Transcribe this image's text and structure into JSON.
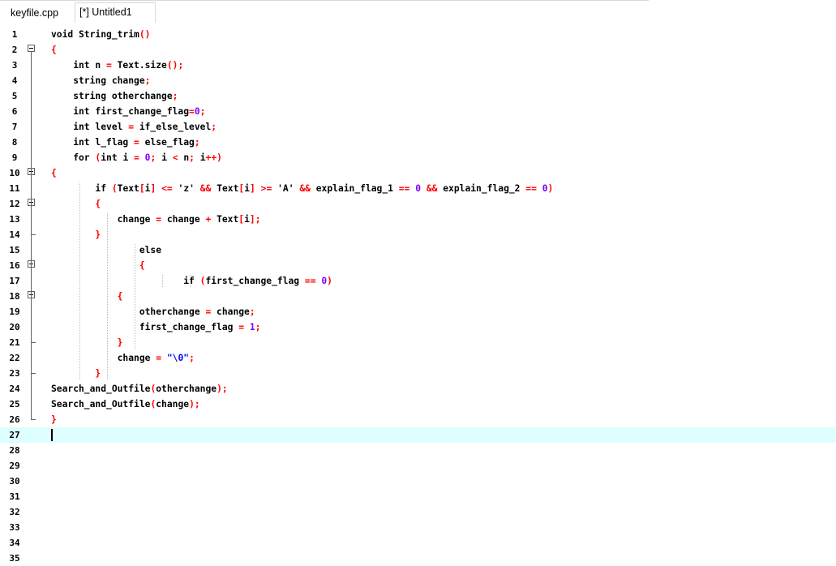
{
  "tabs": [
    {
      "label": "keyfile.cpp",
      "active": false
    },
    {
      "label": "[*] Untitled1",
      "active": true
    }
  ],
  "editor": {
    "current_line": 27,
    "lines": [
      {
        "n": "1",
        "code": "void String_trim()"
      },
      {
        "n": "2",
        "code": "{"
      },
      {
        "n": "3",
        "code": "    int n = Text.size();"
      },
      {
        "n": "4",
        "code": "    string change;"
      },
      {
        "n": "5",
        "code": "    string otherchange;"
      },
      {
        "n": "6",
        "code": "    int first_change_flag=0;"
      },
      {
        "n": "7",
        "code": "    int level = if_else_level;"
      },
      {
        "n": "8",
        "code": "    int l_flag = else_flag;"
      },
      {
        "n": "9",
        "code": "    for (int i = 0; i < n; i++)"
      },
      {
        "n": "10",
        "code": "{"
      },
      {
        "n": "11",
        "code": "        if (Text[i] <= 'z' && Text[i] >= 'A' && explain_flag_1 == 0 && explain_flag_2 == 0)"
      },
      {
        "n": "12",
        "code": "        {"
      },
      {
        "n": "13",
        "code": "            change = change + Text[i];"
      },
      {
        "n": "14",
        "code": "        }"
      },
      {
        "n": "15",
        "code": "                else"
      },
      {
        "n": "16",
        "code": "                {"
      },
      {
        "n": "17",
        "code": "                        if (first_change_flag == 0)"
      },
      {
        "n": "18",
        "code": "            {"
      },
      {
        "n": "19",
        "code": "                otherchange = change;"
      },
      {
        "n": "20",
        "code": "                first_change_flag = 1;"
      },
      {
        "n": "21",
        "code": "            }"
      },
      {
        "n": "22",
        "code": "            change = \"\\0\";"
      },
      {
        "n": "23",
        "code": "        }"
      },
      {
        "n": "24",
        "code": "Search_and_Outfile(otherchange);"
      },
      {
        "n": "25",
        "code": "Search_and_Outfile(change);"
      },
      {
        "n": "26",
        "code": "}"
      },
      {
        "n": "27",
        "code": ""
      },
      {
        "n": "28",
        "code": ""
      },
      {
        "n": "29",
        "code": ""
      },
      {
        "n": "30",
        "code": ""
      },
      {
        "n": "31",
        "code": ""
      },
      {
        "n": "32",
        "code": ""
      },
      {
        "n": "33",
        "code": ""
      },
      {
        "n": "34",
        "code": ""
      },
      {
        "n": "35",
        "code": ""
      }
    ]
  },
  "colors": {
    "current_line_bg": "#ddffff",
    "bracket": "#ff0000",
    "number": "#8000ff",
    "string": "#0000ff"
  }
}
